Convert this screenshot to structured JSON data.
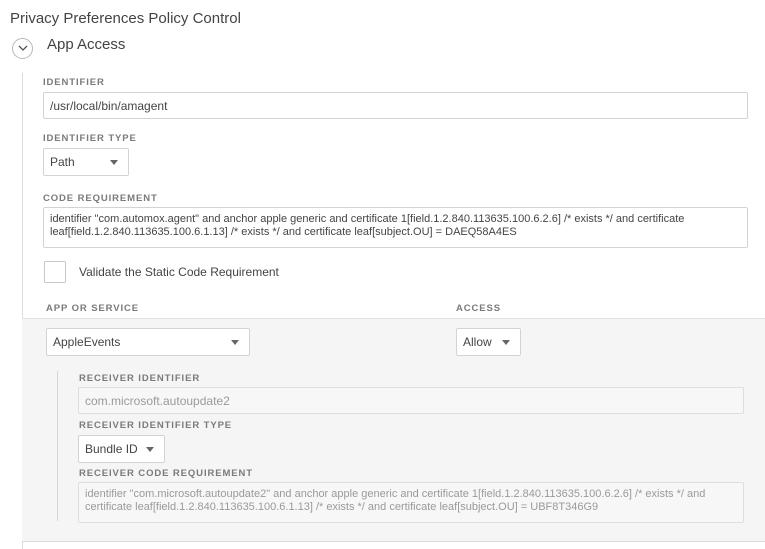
{
  "page": {
    "title": "Privacy Preferences Policy Control"
  },
  "section": {
    "title": "App Access"
  },
  "identifier": {
    "label": "IDENTIFIER",
    "value": "/usr/local/bin/amagent"
  },
  "identifier_type": {
    "label": "IDENTIFIER TYPE",
    "value": "Path"
  },
  "code_requirement": {
    "label": "CODE REQUIREMENT",
    "value": "identifier \"com.automox.agent\" and anchor apple generic and certificate 1[field.1.2.840.113635.100.6.2.6] /* exists */ and certificate\nleaf[field.1.2.840.113635.100.6.1.13] /* exists */ and certificate leaf[subject.OU] = DAEQ58A4ES"
  },
  "validate": {
    "label": "Validate the Static Code Requirement",
    "checked": false
  },
  "app_service": {
    "label": "APP OR SERVICE",
    "value": "AppleEvents"
  },
  "access": {
    "label": "ACCESS",
    "value": "Allow"
  },
  "receiver_identifier": {
    "label": "RECEIVER IDENTIFIER",
    "value": "com.microsoft.autoupdate2"
  },
  "receiver_identifier_type": {
    "label": "RECEIVER IDENTIFIER TYPE",
    "value": "Bundle ID"
  },
  "receiver_code_requirement": {
    "label": "RECEIVER CODE REQUIREMENT",
    "value": "identifier \"com.microsoft.autoupdate2\" and anchor apple generic and certificate 1[field.1.2.840.113635.100.6.2.6] /* exists */ and\ncertificate leaf[field.1.2.840.113635.100.6.1.13] /* exists */ and certificate leaf[subject.OU] = UBF8T346G9"
  },
  "icons": {
    "collapse": "chevron-down-icon",
    "dropdown": "caret-down-icon"
  },
  "colors": {
    "panel_bg": "#f5f5f5",
    "border": "#d3d3d3",
    "label": "#7a7a7a"
  }
}
